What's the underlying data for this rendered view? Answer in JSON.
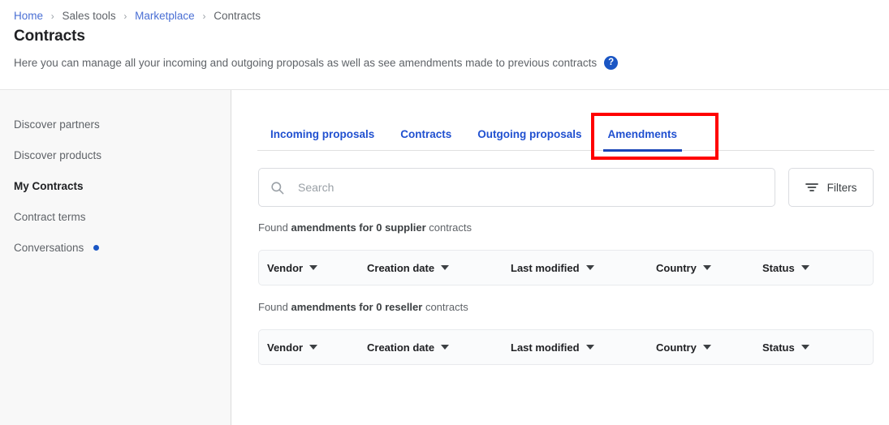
{
  "breadcrumb": [
    {
      "label": "Home",
      "type": "link"
    },
    {
      "label": "Sales tools",
      "type": "plain"
    },
    {
      "label": "Marketplace",
      "type": "link"
    },
    {
      "label": "Contracts",
      "type": "plain"
    }
  ],
  "breadcrumb_separator": "›",
  "header": {
    "title": "Contracts",
    "description": "Here you can manage all your incoming and outgoing proposals as well as see amendments made to previous contracts",
    "help_icon_glyph": "?",
    "help_icon_name": "help-circle-icon"
  },
  "sidebar": {
    "items": [
      {
        "label": "Discover partners",
        "active": false,
        "badge": false
      },
      {
        "label": "Discover products",
        "active": false,
        "badge": false
      },
      {
        "label": "My Contracts",
        "active": true,
        "badge": false
      },
      {
        "label": "Contract terms",
        "active": false,
        "badge": false
      },
      {
        "label": "Conversations",
        "active": false,
        "badge": true
      }
    ]
  },
  "tabs": [
    {
      "label": "Incoming proposals",
      "active": false
    },
    {
      "label": "Contracts",
      "active": false
    },
    {
      "label": "Outgoing proposals",
      "active": false
    },
    {
      "label": "Amendments",
      "active": true
    }
  ],
  "search": {
    "placeholder": "Search",
    "value": "",
    "icon_name": "search-icon"
  },
  "filters": {
    "label": "Filters",
    "icon_name": "filter-icon"
  },
  "sections": [
    {
      "result_prefix": "Found ",
      "result_strong": "amendments for 0 supplier",
      "result_suffix": " contracts",
      "columns": [
        "Vendor",
        "Creation date",
        "Last modified",
        "Country",
        "Status"
      ]
    },
    {
      "result_prefix": "Found ",
      "result_strong": "amendments for 0 reseller",
      "result_suffix": " contracts",
      "columns": [
        "Vendor",
        "Creation date",
        "Last modified",
        "Country",
        "Status"
      ]
    }
  ],
  "annotation": {
    "highlight_color": "#ff0000",
    "highlight_target": "Amendments"
  },
  "colors": {
    "link": "#4a6fd4",
    "tab": "#2050d0",
    "accent": "#1a56c4",
    "sidebar_bg": "#f8f8f8"
  }
}
